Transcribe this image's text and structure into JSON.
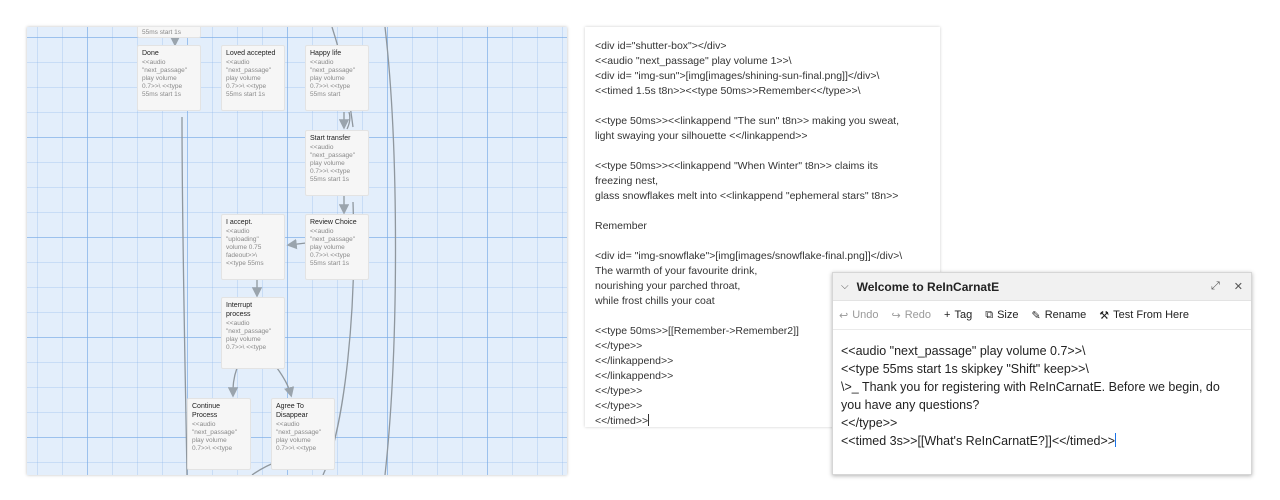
{
  "story_map": {
    "cards": [
      {
        "id": "top",
        "title": "",
        "text": "55ms start 1s"
      },
      {
        "id": "done",
        "title": "Done",
        "text": "<<audio\n\"next_passage\"\nplay volume\n0.7>>\\ <<type\n55ms start 1s"
      },
      {
        "id": "loved",
        "title": "Loved accepted",
        "text": "<<audio\n\"next_passage\"\nplay volume\n0.7>>\\ <<type\n55ms start 1s"
      },
      {
        "id": "happy",
        "title": "Happy life",
        "text": "<<audio\n\"next_passage\"\nplay volume\n0.7>>\\ <<type\n55ms start"
      },
      {
        "id": "transfer",
        "title": "Start transfer",
        "text": "<<audio\n\"next_passage\"\nplay volume\n0.7>>\\ <<type\n55ms start 1s"
      },
      {
        "id": "accept",
        "title": "I accept.",
        "text": "<<audio\n\"uploading\"\nvolume 0.75\nfadeout>>\\\n<<type 55ms"
      },
      {
        "id": "review",
        "title": "Review Choice",
        "text": "<<audio\n\"next_passage\"\nplay volume\n0.7>>\\ <<type\n55ms start 1s"
      },
      {
        "id": "interrupt",
        "title": "Interrupt\nprocess",
        "text": "<<audio\n\"next_passage\"\nplay volume\n0.7>>\\ <<type"
      },
      {
        "id": "continue",
        "title": "Continue\nProcess",
        "text": "<<audio\n\"next_passage\"\nplay volume\n0.7>>\\ <<type"
      },
      {
        "id": "agree",
        "title": "Agree To\nDisappear",
        "text": "<<audio\n\"next_passage\"\nplay volume\n0.7>>\\ <<type"
      }
    ]
  },
  "code_panel": {
    "text": "<div id=\"shutter-box\"></div>\n<<audio \"next_passage\" play volume 1>>\\\n<div id= \"img-sun\">[img[images/shining-sun-final.png]]</div>\\\n<<timed 1.5s t8n>><<type 50ms>>Remember<</type>>\\\n\n<<type 50ms>><<linkappend \"The sun\" t8n>> making you sweat,\nlight swaying your silhouette <</linkappend>>\n\n<<type 50ms>><<linkappend \"When Winter\" t8n>> claims its\nfreezing nest,\nglass snowflakes melt into <<linkappend \"ephemeral stars\" t8n>>\n\nRemember\n\n<div id= \"img-snowflake\">[img[images/snowflake-final.png]]</div>\\\nThe warmth of your favourite drink,\nnourishing your parched throat,\nwhile frost chills your coat\n\n<<type 50ms>>[[Remember->Remember2]]\n<</type>>\n<</linkappend>>\n<</linkappend>>\n<</type>>\n<</type>>\n<</timed>>"
  },
  "dialog": {
    "title": "Welcome to ReInCarnatE",
    "toolbar": {
      "undo": "Undo",
      "redo": "Redo",
      "tag": "Tag",
      "size": "Size",
      "rename": "Rename",
      "test": "Test From Here"
    },
    "body": "<<audio \"next_passage\" play volume 0.7>>\\\n<<type 55ms start 1s skipkey \"Shift\" keep>>\\\n\\>_ Thank you for registering with ReInCarnatE. Before we begin, do you have any questions?\n<</type>>\n<<timed 3s>>[[What's ReInCarnatE?]]<</timed>>"
  }
}
